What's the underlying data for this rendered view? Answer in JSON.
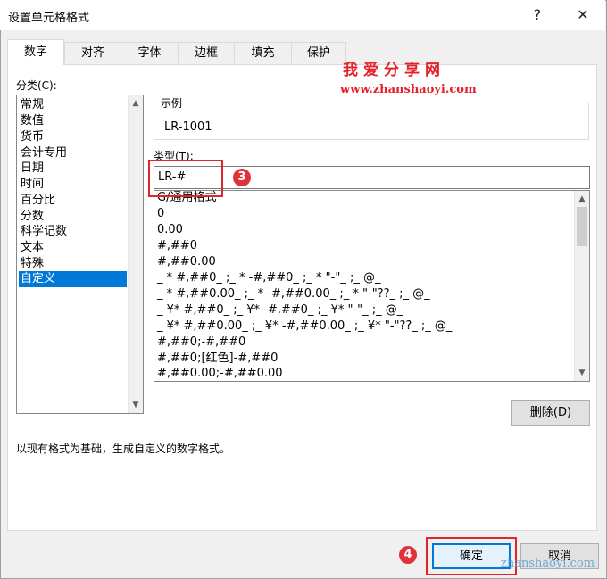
{
  "window": {
    "title": "设置单元格格式",
    "help_glyph": "?",
    "close_glyph": "✕"
  },
  "tabs": [
    "数字",
    "对齐",
    "字体",
    "边框",
    "填充",
    "保护"
  ],
  "active_tab": "数字",
  "category": {
    "label": "分类(C):",
    "items": [
      "常规",
      "数值",
      "货币",
      "会计专用",
      "日期",
      "时间",
      "百分比",
      "分数",
      "科学记数",
      "文本",
      "特殊",
      "自定义"
    ],
    "selected": "自定义"
  },
  "sample": {
    "legend": "示例",
    "value": "LR-1001"
  },
  "type": {
    "label": "类型(T):",
    "value": "LR-#"
  },
  "formats": [
    "G/通用格式",
    "0",
    "0.00",
    "#,##0",
    "#,##0.00",
    "_ * #,##0_ ;_ * -#,##0_ ;_ * \"-\"_ ;_ @_",
    "_ * #,##0.00_ ;_ * -#,##0.00_ ;_ * \"-\"??_ ;_ @_",
    "_ ¥* #,##0_ ;_ ¥* -#,##0_ ;_ ¥* \"-\"_ ;_ @_",
    "_ ¥* #,##0.00_ ;_ ¥* -#,##0.00_ ;_ ¥* \"-\"??_ ;_ @_",
    "#,##0;-#,##0",
    "#,##0;[红色]-#,##0",
    "#,##0.00;-#,##0.00"
  ],
  "buttons": {
    "delete": "删除(D)",
    "ok": "确定",
    "cancel": "取消"
  },
  "description": "以现有格式为基础，生成自定义的数字格式。",
  "annotations": {
    "step3": "3",
    "step4": "4"
  },
  "watermark": {
    "title": "我爱分享网",
    "url": "www.zhanshaoyi.com",
    "bottom": "zhanshaoyi.com"
  },
  "colors": {
    "selection": "#0078d7",
    "annotation_red": "#e0242b",
    "watermark_red": "#e5202a"
  }
}
